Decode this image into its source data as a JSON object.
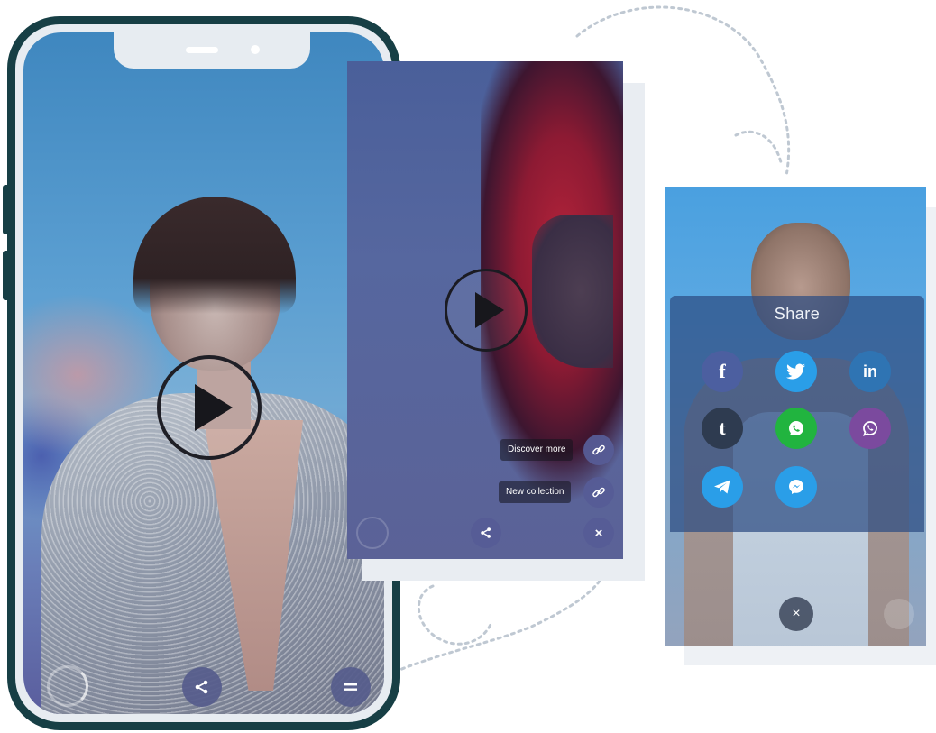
{
  "phone_left": {
    "buttons": [
      {
        "name": "share",
        "glyph": "<",
        "icon": "share-icon"
      },
      {
        "name": "menu",
        "glyph": "=",
        "icon": "menu-icon"
      }
    ],
    "play_icon": "play-icon"
  },
  "middle_screen": {
    "play_icon": "play-icon",
    "menu_items": [
      {
        "label": "Discover more",
        "icon": "link-icon"
      },
      {
        "label": "New collection",
        "icon": "link-icon"
      }
    ],
    "share_icon": "share-icon",
    "close_glyph": "×"
  },
  "right_screen": {
    "share_title": "Share",
    "social": [
      {
        "name": "facebook",
        "glyph": "f",
        "color": "#4c5fa0"
      },
      {
        "name": "twitter",
        "glyph": "",
        "color": "#2a9ee8"
      },
      {
        "name": "linkedin",
        "glyph": "in",
        "color": "#2f74b3"
      },
      {
        "name": "tumblr",
        "glyph": "t",
        "color": "#2e3b50"
      },
      {
        "name": "whatsapp",
        "glyph": "",
        "color": "#21b43f"
      },
      {
        "name": "viber",
        "glyph": "",
        "color": "#7b4a9e"
      },
      {
        "name": "telegram",
        "glyph": "",
        "color": "#2a9ee8"
      },
      {
        "name": "messenger",
        "glyph": "",
        "color": "#2a9ee8"
      }
    ],
    "close_glyph": "×"
  },
  "colors": {
    "phone_frame": "#173f45",
    "accent_button": "#565c8c"
  }
}
